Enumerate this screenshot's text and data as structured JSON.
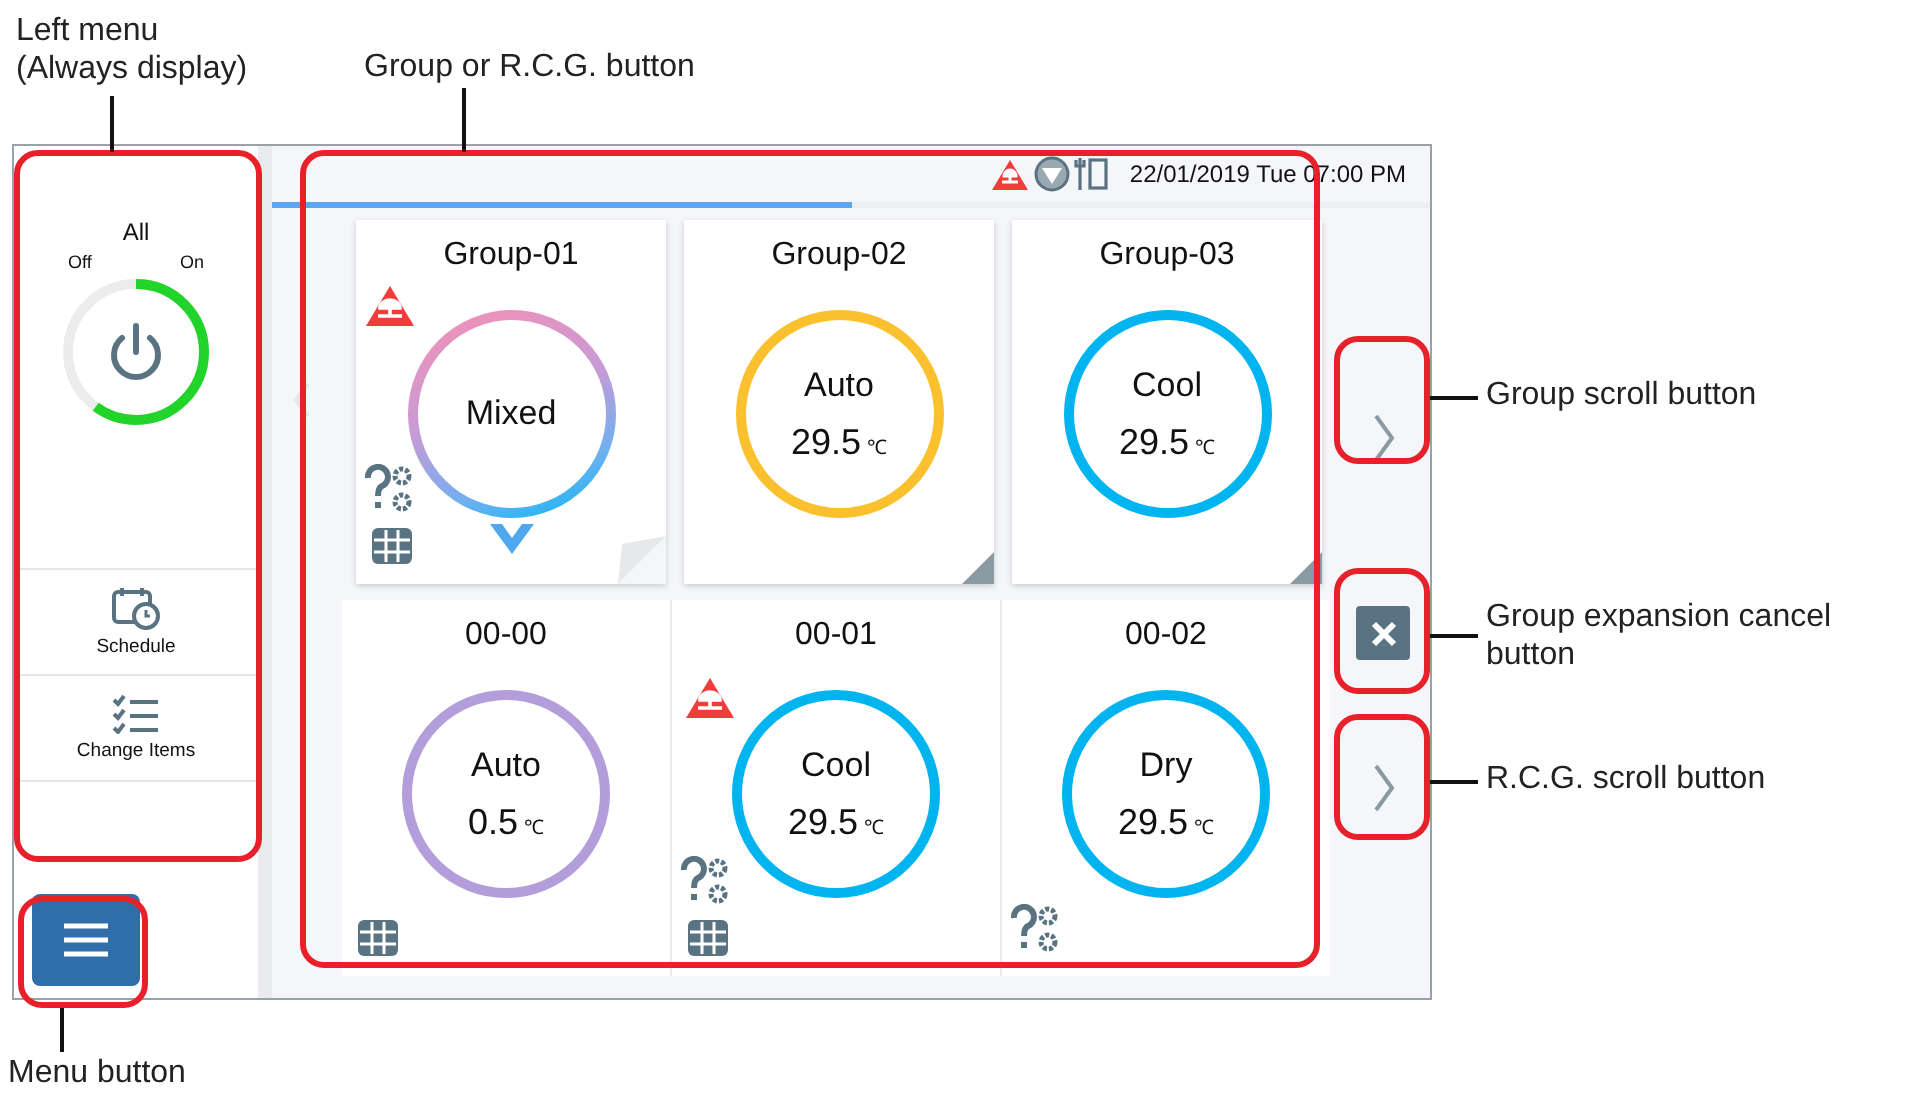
{
  "callouts": [
    {
      "lines": [
        "Left menu",
        "(Always display)"
      ]
    },
    {
      "lines": [
        "Group or R.C.G. button"
      ]
    },
    {
      "lines": [
        "Group scroll button"
      ]
    },
    {
      "lines": [
        "Group expansion cancel",
        "button"
      ]
    },
    {
      "lines": [
        "R.C.G. scroll button"
      ]
    },
    {
      "lines": [
        "Menu button"
      ]
    }
  ],
  "status_bar": {
    "datetime": "22/01/2019 Tue 07:00 PM"
  },
  "progress": {
    "level": 0.5
  },
  "left_menu": {
    "all_label": "All",
    "off_label": "Off",
    "on_label": "On",
    "level": 0.6,
    "items": [
      {
        "label": "Schedule",
        "kind": "schedule"
      },
      {
        "label": "Change Items",
        "kind": "change"
      }
    ]
  },
  "groups": [
    {
      "name": "Group-01",
      "mode": "Mixed",
      "kind": "gradient",
      "expanded": true,
      "warning": true,
      "maintenance": true,
      "schedule": true
    },
    {
      "name": "Group-02",
      "mode": "Auto",
      "temp": "29.5",
      "unit": "℃",
      "kind": "solid",
      "color": "#fbc02d",
      "expanded": false,
      "warning": false,
      "maintenance": false,
      "schedule": false
    },
    {
      "name": "Group-03",
      "mode": "Cool",
      "temp": "29.5",
      "unit": "℃",
      "kind": "solid",
      "color": "#00b4f0",
      "expanded": false,
      "warning": false,
      "maintenance": false,
      "schedule": false
    }
  ],
  "rcgs": [
    {
      "name": "00-00",
      "mode": "Auto",
      "temp": "0.5",
      "unit": "℃",
      "kind": "solid",
      "color": "#b39ddb",
      "warning": false,
      "maintenance": false,
      "schedule": true
    },
    {
      "name": "00-01",
      "mode": "Cool",
      "temp": "29.5",
      "unit": "℃",
      "kind": "solid",
      "color": "#00b4f0",
      "warning": true,
      "maintenance": true,
      "schedule": true
    },
    {
      "name": "00-02",
      "mode": "Dry",
      "temp": "29.5",
      "unit": "℃",
      "kind": "solid",
      "color": "#00b4f0",
      "warning": false,
      "maintenance": true,
      "schedule": false
    }
  ]
}
